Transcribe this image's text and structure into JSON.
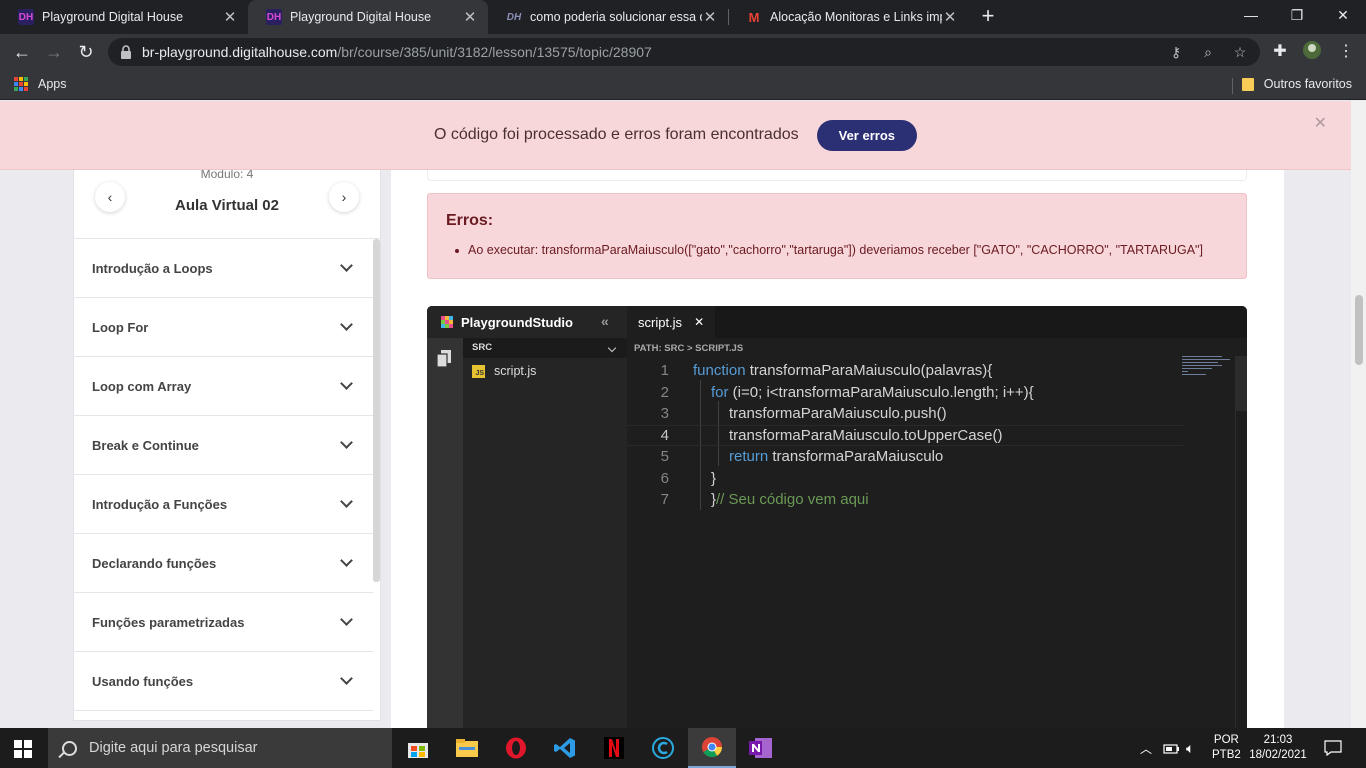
{
  "browser": {
    "tabs": [
      {
        "title": "Playground Digital House",
        "icon": "dh-icon",
        "active": false
      },
      {
        "title": "Playground Digital House",
        "icon": "dh-icon",
        "active": true
      },
      {
        "title": "como poderia solucionar essa qu",
        "icon": "dh-forum-icon",
        "active": false
      },
      {
        "title": "Alocação Monitoras e Links impo",
        "icon": "gmail-icon",
        "active": false
      }
    ],
    "fav_dh": "DH",
    "fav_gmail": "M",
    "fav_forum": "DH",
    "url_domain": "br-playground.digitalhouse.com",
    "url_path": "/br/course/385/unit/3182/lesson/13575/topic/28907",
    "bookmarks": {
      "apps": "Apps",
      "others": "Outros favoritos"
    }
  },
  "banner": {
    "message": "O código foi processado e erros foram encontrados",
    "button": "Ver erros",
    "bg_color": "#f7d7da",
    "button_color": "#2b2f74"
  },
  "sidebar": {
    "module": "Modulo: 4",
    "title": "Aula Virtual 02",
    "items": [
      {
        "label": "Introdução a Loops"
      },
      {
        "label": "Loop For"
      },
      {
        "label": "Loop com Array"
      },
      {
        "label": "Break e Continue"
      },
      {
        "label": "Introdução a Funções"
      },
      {
        "label": "Declarando funções"
      },
      {
        "label": "Funções parametrizadas"
      },
      {
        "label": "Usando funções"
      }
    ]
  },
  "errors": {
    "heading": "Erros:",
    "items": [
      "Ao executar: transformaParaMaiusculo([\"gato\",\"cachorro\",\"tartaruga\"]) deveriamos receber [\"GATO\", \"CACHORRO\", \"TARTARUGA\"]"
    ]
  },
  "ide": {
    "brand": "PlaygroundStudio",
    "tab": "script.js",
    "folder": "SRC",
    "file": "script.js",
    "path": "PATH: SRC > SCRIPT.JS",
    "js_badge": "JS",
    "current_line": 4,
    "lines": [
      {
        "n": "1",
        "kw": "function",
        "text": " transformaParaMaiusculo(palavras){",
        "comment": ""
      },
      {
        "n": "2",
        "kw": "for",
        "text": " (i=0; i<transformaParaMaiusculo.length; i++){",
        "comment": ""
      },
      {
        "n": "3",
        "kw": "",
        "text": "transformaParaMaiusculo.push()",
        "comment": ""
      },
      {
        "n": "4",
        "kw": "",
        "text": "transformaParaMaiusculo.toUpperCase()",
        "comment": ""
      },
      {
        "n": "5",
        "kw": "return",
        "text": " transformaParaMaiusculo",
        "comment": ""
      },
      {
        "n": "6",
        "kw": "",
        "text": "}",
        "comment": ""
      },
      {
        "n": "7",
        "kw": "",
        "text": "}",
        "comment": "// Seu código vem aqui"
      }
    ]
  },
  "taskbar": {
    "search_placeholder": "Digite aqui para pesquisar",
    "lang1": "POR",
    "lang2": "PTB2",
    "time": "21:03",
    "date": "18/02/2021"
  }
}
